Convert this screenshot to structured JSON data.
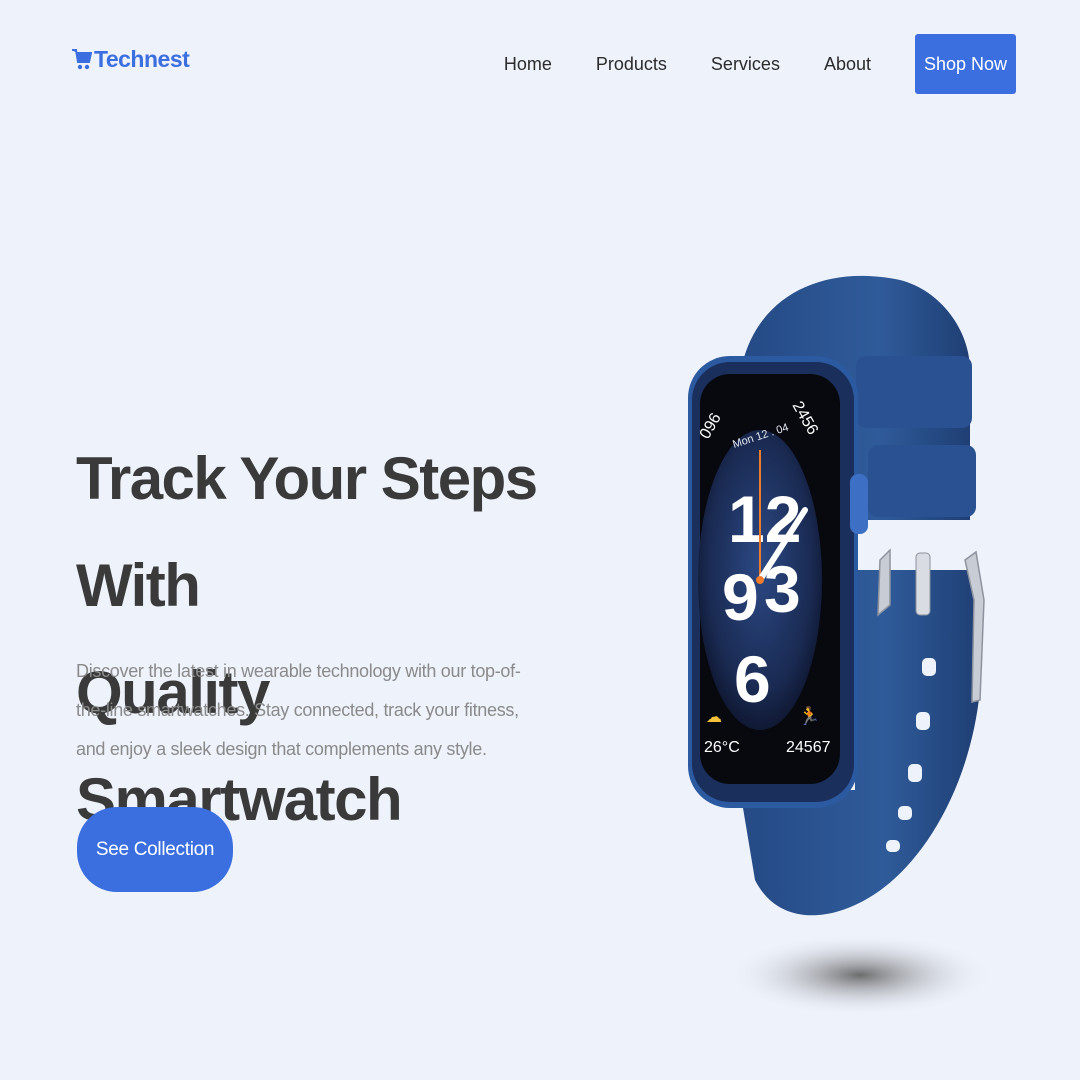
{
  "brand": {
    "name": "Technest",
    "icon": "cart-icon",
    "color": "#3b6fe0"
  },
  "nav": {
    "links": [
      "Home",
      "Products",
      "Services",
      "About"
    ],
    "cta_label": "Shop Now"
  },
  "hero": {
    "title_line1": "Track Your Steps With",
    "title_line2": "Quality Smartwatch",
    "description": "Discover the latest in wearable technology with our top-of-the-line smartwatches. Stay connected, track your fitness, and enjoy a sleek design that complements any style.",
    "button_label": "See Collection"
  },
  "watch": {
    "face": {
      "heart_rate": "096",
      "steps_top": "2456",
      "date": "Mon 12 . 04",
      "hour_top": "12",
      "hour_left": "9",
      "hour_right": "3",
      "hour_bottom": "6",
      "temperature": "26°C",
      "steps_bottom": "24567"
    },
    "strap_color": "#2f5b9a"
  },
  "colors": {
    "accent": "#3b6fe0",
    "background": "#eef2fb",
    "text": "#3a3a3a",
    "muted": "#8a8a8a"
  }
}
